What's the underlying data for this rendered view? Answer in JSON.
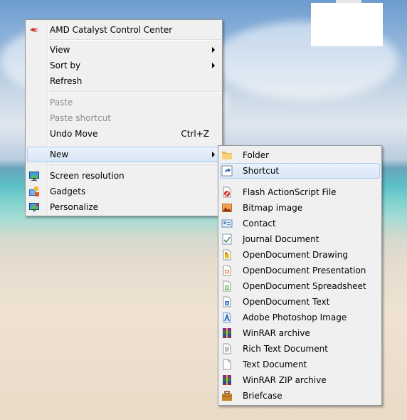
{
  "context_menu": {
    "top_item": {
      "label": "AMD Catalyst Control Center",
      "icon": "amd-catalyst-icon"
    },
    "view": {
      "label": "View"
    },
    "sort_by": {
      "label": "Sort by"
    },
    "refresh": {
      "label": "Refresh"
    },
    "paste": {
      "label": "Paste"
    },
    "paste_shortcut": {
      "label": "Paste shortcut"
    },
    "undo_move": {
      "label": "Undo Move",
      "shortcut": "Ctrl+Z"
    },
    "new": {
      "label": "New"
    },
    "screen_resolution": {
      "label": "Screen resolution",
      "icon": "monitor-icon"
    },
    "gadgets": {
      "label": "Gadgets",
      "icon": "gadgets-icon"
    },
    "personalize": {
      "label": "Personalize",
      "icon": "personalize-icon"
    }
  },
  "new_submenu": {
    "folder": {
      "label": "Folder",
      "icon": "folder-icon"
    },
    "shortcut": {
      "label": "Shortcut",
      "icon": "shortcut-icon"
    },
    "items": [
      {
        "label": "Flash ActionScript File",
        "icon": "flash-file-icon"
      },
      {
        "label": "Bitmap image",
        "icon": "bitmap-icon"
      },
      {
        "label": "Contact",
        "icon": "contact-icon"
      },
      {
        "label": "Journal Document",
        "icon": "journal-icon"
      },
      {
        "label": "OpenDocument Drawing",
        "icon": "odg-icon"
      },
      {
        "label": "OpenDocument Presentation",
        "icon": "odp-icon"
      },
      {
        "label": "OpenDocument Spreadsheet",
        "icon": "ods-icon"
      },
      {
        "label": "OpenDocument Text",
        "icon": "odt-icon"
      },
      {
        "label": "Adobe Photoshop Image",
        "icon": "photoshop-icon"
      },
      {
        "label": "WinRAR archive",
        "icon": "winrar-icon"
      },
      {
        "label": "Rich Text Document",
        "icon": "rtf-icon"
      },
      {
        "label": "Text Document",
        "icon": "text-document-icon"
      },
      {
        "label": "WinRAR ZIP archive",
        "icon": "winrar-zip-icon"
      },
      {
        "label": "Briefcase",
        "icon": "briefcase-icon"
      }
    ]
  }
}
